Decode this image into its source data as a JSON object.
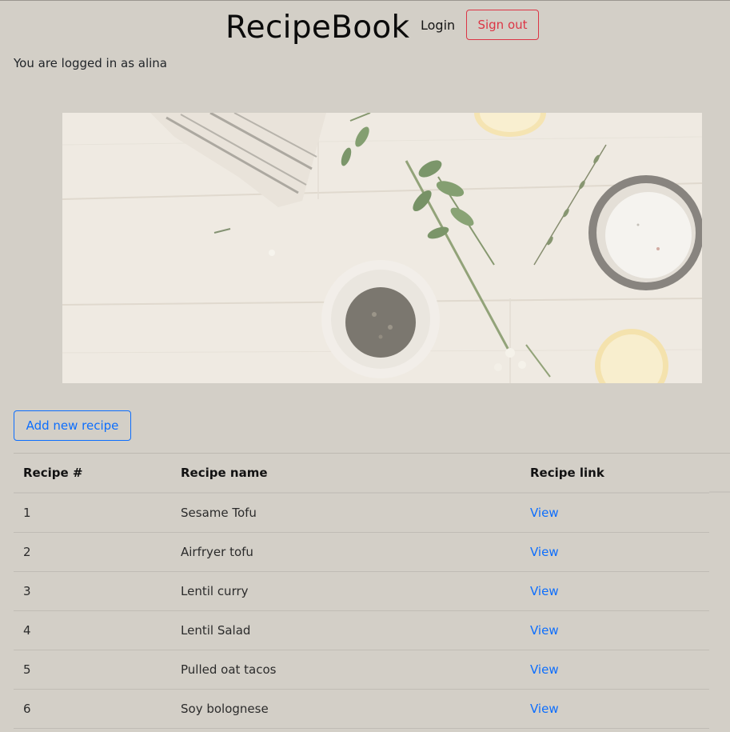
{
  "header": {
    "brand": "RecipeBook",
    "login_label": "Login",
    "signout_label": "Sign out"
  },
  "status": {
    "logged_in_text": "You are logged in as alina"
  },
  "actions": {
    "add_recipe_label": "Add new recipe"
  },
  "table": {
    "columns": [
      "Recipe #",
      "Recipe name",
      "Recipe link"
    ],
    "rows": [
      {
        "num": "1",
        "name": "Sesame Tofu",
        "link": "View"
      },
      {
        "num": "2",
        "name": "Airfryer tofu",
        "link": "View"
      },
      {
        "num": "3",
        "name": "Lentil curry",
        "link": "View"
      },
      {
        "num": "4",
        "name": "Lentil Salad",
        "link": "View"
      },
      {
        "num": "5",
        "name": "Pulled oat tacos",
        "link": "View"
      },
      {
        "num": "6",
        "name": "Soy bolognese",
        "link": "View"
      }
    ]
  },
  "colors": {
    "background": "#d3cfc7",
    "primary": "#0d6efd",
    "danger": "#dc3545"
  }
}
